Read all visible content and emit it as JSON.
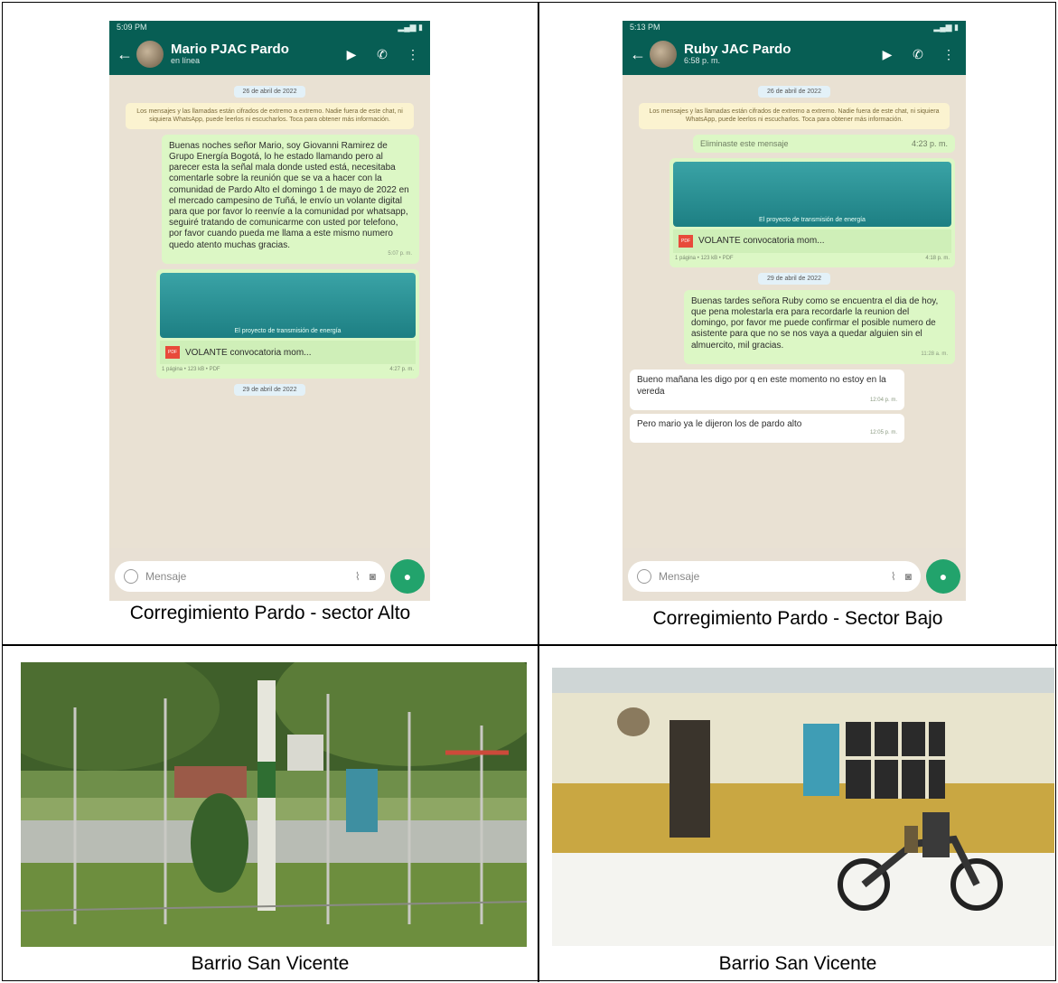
{
  "cells": [
    {
      "caption": "Corregimiento Pardo - sector Alto",
      "phone": {
        "status_time": "5:09 PM",
        "contact_name": "Mario PJAC Pardo",
        "contact_status": "en línea",
        "date_pill_1": "26 de abril de 2022",
        "encryption_note": "Los mensajes y las llamadas están cifrados de extremo a extremo. Nadie fuera de este chat, ni siquiera WhatsApp, puede leerlos ni escucharlos. Toca para obtener más información.",
        "message_text": "Buenas noches señor Mario, soy Giovanni Ramirez de Grupo Energía Bogotá, lo he estado llamando pero al parecer esta la señal mala donde usted está, necesitaba comentarle sobre la reunión que se va a hacer con la comunidad de Pardo Alto el domingo 1 de mayo de 2022 en el mercado campesino de Tuñá, le envío un volante digital para que por favor lo reenvíe a la comunidad por whatsapp, seguiré tratando de comunicarme con usted por telefono, por favor cuando pueda me llama a este mismo numero quedo atento muchas gracias.",
        "message_time": "5:07 p. m.",
        "card_caption": "El proyecto de transmisión de energía",
        "file_name": "VOLANTE convocatoria mom...",
        "file_meta": "1 página • 123 kB • PDF",
        "file_time": "4:27 p. m.",
        "date_pill_2": "29 de abril de 2022",
        "input_placeholder": "Mensaje"
      }
    },
    {
      "caption": "Corregimiento Pardo - Sector Bajo",
      "phone": {
        "status_time": "5:13 PM",
        "contact_name": "Ruby JAC Pardo",
        "contact_status": "6:58 p. m.",
        "date_pill_1": "26 de abril de 2022",
        "encryption_note": "Los mensajes y las llamadas están cifrados de extremo a extremo. Nadie fuera de este chat, ni siquiera WhatsApp, puede leerlos ni escucharlos. Toca para obtener más información.",
        "deleted_text": "Eliminaste este mensaje",
        "deleted_time": "4:23 p. m.",
        "card_caption": "El proyecto de transmisión de energía",
        "file_name": "VOLANTE convocatoria mom...",
        "file_meta": "1 página • 123 kB • PDF",
        "file_time": "4:18 p. m.",
        "date_pill_2": "29 de abril de 2022",
        "message_text": "Buenas tardes señora Ruby como se encuentra el dia de hoy, que pena molestarla era para recordarle la reunion del domingo, por favor me puede confirmar el posible numero de asistente para que no se nos vaya a quedar alguien sin el almuercito, mil gracias.",
        "message_time": "11:28 a. m.",
        "reply_1": "Bueno mañana les digo por q en este momento no estoy en la vereda",
        "reply_1_time": "12:04 p. m.",
        "reply_2": "Pero mario ya le dijeron los de pardo alto",
        "reply_2_time": "12:05 p. m.",
        "input_placeholder": "Mensaje"
      }
    },
    {
      "caption": "Barrio San Vicente"
    },
    {
      "caption": "Barrio San Vicente"
    }
  ]
}
